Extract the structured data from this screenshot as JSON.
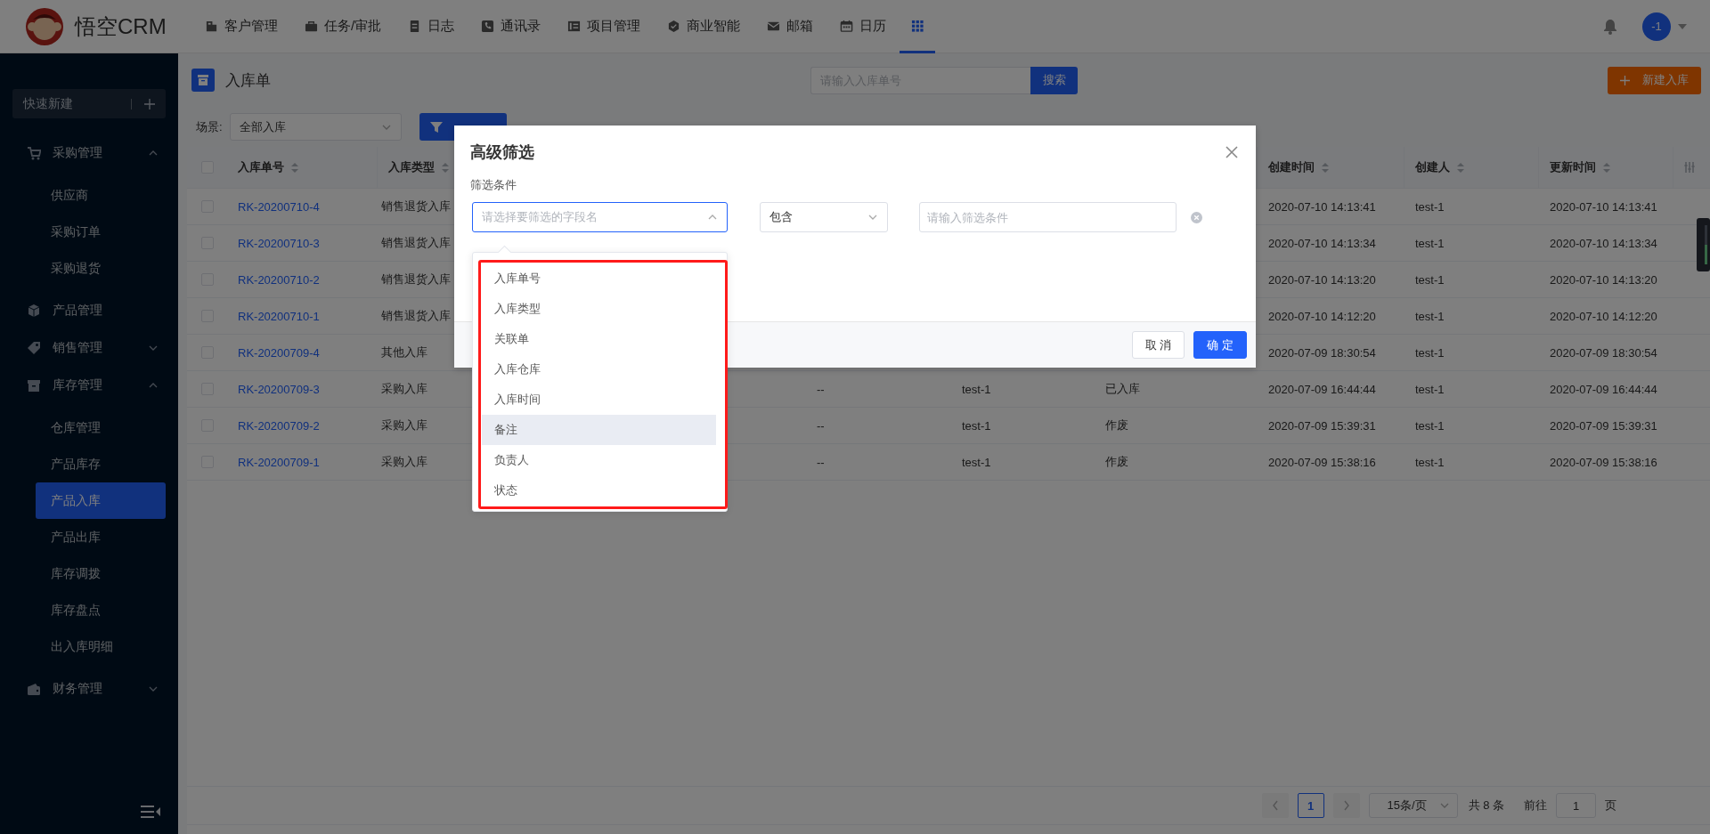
{
  "app": {
    "logo_text": "悟空CRM"
  },
  "nav": [
    {
      "label": "客户管理",
      "selected": false
    },
    {
      "label": "任务/审批",
      "selected": false
    },
    {
      "label": "日志",
      "selected": false
    },
    {
      "label": "通讯录",
      "selected": false
    },
    {
      "label": "项目管理",
      "selected": false
    },
    {
      "label": "商业智能",
      "selected": false
    },
    {
      "label": "邮箱",
      "selected": false
    },
    {
      "label": "日历",
      "selected": false
    }
  ],
  "apps_button": {
    "selected": true
  },
  "user": {
    "avatar_text": "-1"
  },
  "sidebar": {
    "quick_create": "快速新建",
    "items": [
      {
        "label": "采购管理",
        "expanded": true,
        "children": [
          {
            "label": "供应商",
            "selected": false
          },
          {
            "label": "采购订单",
            "selected": false
          },
          {
            "label": "采购退货",
            "selected": false
          }
        ]
      },
      {
        "label": "产品管理"
      },
      {
        "label": "销售管理",
        "expanded": false
      },
      {
        "label": "库存管理",
        "expanded": true,
        "children": [
          {
            "label": "仓库管理",
            "selected": false
          },
          {
            "label": "产品库存",
            "selected": false
          },
          {
            "label": "产品入库",
            "selected": true
          },
          {
            "label": "产品出库",
            "selected": false
          },
          {
            "label": "库存调拨",
            "selected": false
          },
          {
            "label": "库存盘点",
            "selected": false
          },
          {
            "label": "出入库明细",
            "selected": false
          }
        ]
      },
      {
        "label": "财务管理",
        "expanded": false
      }
    ]
  },
  "page": {
    "title": "入库单",
    "search_placeholder": "请输入入库单号",
    "search_button": "搜索",
    "create_button": "新建入库",
    "scene_label": "场景:",
    "scene_value": "全部入库"
  },
  "table": {
    "header_checked": false,
    "columns": [
      {
        "label": "入库单号"
      },
      {
        "label": "入库类型"
      },
      {
        "label": "创建时间"
      },
      {
        "label": "创建人"
      },
      {
        "label": "更新时间"
      }
    ],
    "rows": [
      {
        "checked": false,
        "number": "RK-20200710-4",
        "type": "销售退货入库",
        "created_at": "2020-07-10 14:13:41",
        "creator": "test-1",
        "updated_at": "2020-07-10 14:13:41"
      },
      {
        "checked": false,
        "number": "RK-20200710-3",
        "type": "销售退货入库",
        "created_at": "2020-07-10 14:13:34",
        "creator": "test-1",
        "updated_at": "2020-07-10 14:13:34"
      },
      {
        "checked": false,
        "number": "RK-20200710-2",
        "type": "销售退货入库",
        "created_at": "2020-07-10 14:13:20",
        "creator": "test-1",
        "updated_at": "2020-07-10 14:13:20"
      },
      {
        "checked": false,
        "number": "RK-20200710-1",
        "type": "销售退货入库",
        "created_at": "2020-07-10 14:12:20",
        "creator": "test-1",
        "updated_at": "2020-07-10 14:12:20"
      },
      {
        "checked": false,
        "number": "RK-20200709-4",
        "type": "其他入库",
        "created_at": "2020-07-09 18:30:54",
        "creator": "test-1",
        "updated_at": "2020-07-09 18:30:54"
      },
      {
        "checked": false,
        "number": "RK-20200709-3",
        "type": "采购入库",
        "column_4": "--",
        "column_5": "test-1",
        "column_6": "已入库",
        "created_at": "2020-07-09 16:44:44",
        "creator": "test-1",
        "updated_at": "2020-07-09 16:44:44"
      },
      {
        "checked": false,
        "number": "RK-20200709-2",
        "type": "采购入库",
        "column_4": "--",
        "column_5": "test-1",
        "column_6": "作废",
        "created_at": "2020-07-09 15:39:31",
        "creator": "test-1",
        "updated_at": "2020-07-09 15:39:31"
      },
      {
        "checked": false,
        "number": "RK-20200709-1",
        "type": "采购入库",
        "column_4": "--",
        "column_5": "test-1",
        "column_6": "作废",
        "created_at": "2020-07-09 15:38:16",
        "creator": "test-1",
        "updated_at": "2020-07-09 15:38:16"
      }
    ]
  },
  "pagination": {
    "current_page": "1",
    "page_size": "15条/页",
    "total": "共 8 条",
    "goto_label": "前往",
    "goto_value": "1",
    "page_suffix": "页"
  },
  "modal": {
    "title": "高级筛选",
    "section_label": "筛选条件",
    "field_placeholder": "请选择要筛选的字段名",
    "operator": "包含",
    "value_placeholder": "请输入筛选条件",
    "cancel": "取 消",
    "confirm": "确 定",
    "options": [
      {
        "label": "入库单号",
        "selected": false
      },
      {
        "label": "入库类型",
        "selected": false
      },
      {
        "label": "关联单",
        "selected": false
      },
      {
        "label": "入库仓库",
        "selected": false
      },
      {
        "label": "入库时间",
        "selected": false
      },
      {
        "label": "备注",
        "selected": true
      },
      {
        "label": "负责人",
        "selected": false
      },
      {
        "label": "状态",
        "selected": false
      }
    ]
  }
}
